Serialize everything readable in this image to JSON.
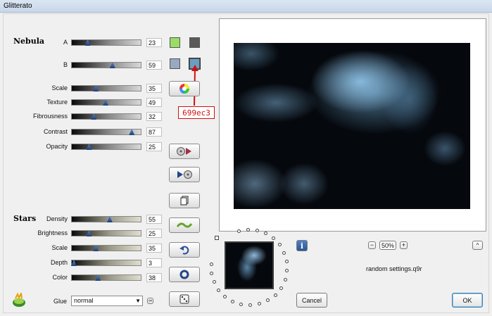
{
  "window": {
    "title": "Glitterato"
  },
  "nebula": {
    "heading": "Nebula",
    "sliders": [
      {
        "id": "a",
        "label": "A",
        "value": "23",
        "fraction": 0.23
      },
      {
        "id": "b",
        "label": "B",
        "value": "59",
        "fraction": 0.59
      },
      {
        "id": "scale",
        "label": "Scale",
        "value": "35",
        "fraction": 0.35
      },
      {
        "id": "texture",
        "label": "Texture",
        "value": "49",
        "fraction": 0.49
      },
      {
        "id": "fibrousness",
        "label": "Fibrousness",
        "value": "32",
        "fraction": 0.32
      },
      {
        "id": "contrast",
        "label": "Contrast",
        "value": "87",
        "fraction": 0.87
      },
      {
        "id": "opacity",
        "label": "Opacity",
        "value": "25",
        "fraction": 0.25
      }
    ],
    "swatches": {
      "a1": "#99dd66",
      "a2": "#5a5a5a",
      "b1": "#9aa8c0",
      "b2": "#699ec3"
    }
  },
  "stars": {
    "heading": "Stars",
    "sliders": [
      {
        "id": "density",
        "label": "Density",
        "value": "55",
        "fraction": 0.55
      },
      {
        "id": "brightness",
        "label": "Brightness",
        "value": "25",
        "fraction": 0.25
      },
      {
        "id": "scale",
        "label": "Scale",
        "value": "35",
        "fraction": 0.35
      },
      {
        "id": "depth",
        "label": "Depth",
        "value": "3",
        "fraction": 0.03
      },
      {
        "id": "color",
        "label": "Color",
        "value": "38",
        "fraction": 0.38
      }
    ]
  },
  "glue": {
    "label": "Glue",
    "value": "normal"
  },
  "annotation": {
    "text": "699ec3",
    "color": "#d01010"
  },
  "zoom": {
    "value": "50%",
    "minus": "−",
    "plus": "+"
  },
  "info_icon": "i",
  "collapse_glyph": "^",
  "settings_file": "random settings.q9r",
  "buttons": {
    "cancel": "Cancel",
    "ok": "OK"
  }
}
